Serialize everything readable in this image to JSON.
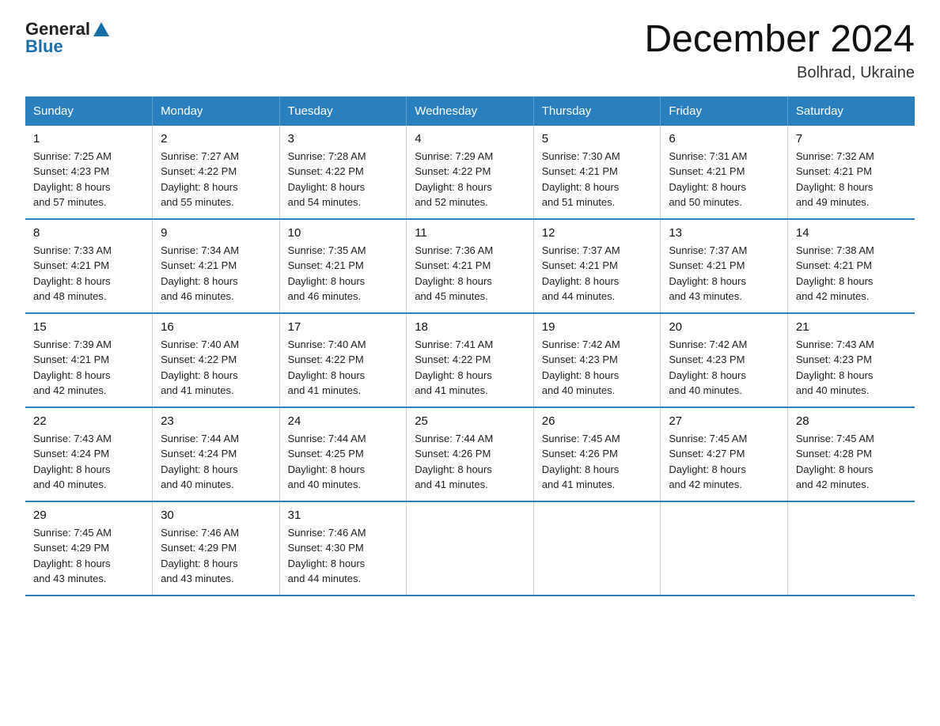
{
  "header": {
    "logo_general": "General",
    "logo_blue": "Blue",
    "month_title": "December 2024",
    "location": "Bolhrad, Ukraine"
  },
  "weekdays": [
    "Sunday",
    "Monday",
    "Tuesday",
    "Wednesday",
    "Thursday",
    "Friday",
    "Saturday"
  ],
  "weeks": [
    [
      {
        "day": "1",
        "sunrise": "Sunrise: 7:25 AM",
        "sunset": "Sunset: 4:23 PM",
        "daylight": "Daylight: 8 hours",
        "minutes": "and 57 minutes."
      },
      {
        "day": "2",
        "sunrise": "Sunrise: 7:27 AM",
        "sunset": "Sunset: 4:22 PM",
        "daylight": "Daylight: 8 hours",
        "minutes": "and 55 minutes."
      },
      {
        "day": "3",
        "sunrise": "Sunrise: 7:28 AM",
        "sunset": "Sunset: 4:22 PM",
        "daylight": "Daylight: 8 hours",
        "minutes": "and 54 minutes."
      },
      {
        "day": "4",
        "sunrise": "Sunrise: 7:29 AM",
        "sunset": "Sunset: 4:22 PM",
        "daylight": "Daylight: 8 hours",
        "minutes": "and 52 minutes."
      },
      {
        "day": "5",
        "sunrise": "Sunrise: 7:30 AM",
        "sunset": "Sunset: 4:21 PM",
        "daylight": "Daylight: 8 hours",
        "minutes": "and 51 minutes."
      },
      {
        "day": "6",
        "sunrise": "Sunrise: 7:31 AM",
        "sunset": "Sunset: 4:21 PM",
        "daylight": "Daylight: 8 hours",
        "minutes": "and 50 minutes."
      },
      {
        "day": "7",
        "sunrise": "Sunrise: 7:32 AM",
        "sunset": "Sunset: 4:21 PM",
        "daylight": "Daylight: 8 hours",
        "minutes": "and 49 minutes."
      }
    ],
    [
      {
        "day": "8",
        "sunrise": "Sunrise: 7:33 AM",
        "sunset": "Sunset: 4:21 PM",
        "daylight": "Daylight: 8 hours",
        "minutes": "and 48 minutes."
      },
      {
        "day": "9",
        "sunrise": "Sunrise: 7:34 AM",
        "sunset": "Sunset: 4:21 PM",
        "daylight": "Daylight: 8 hours",
        "minutes": "and 46 minutes."
      },
      {
        "day": "10",
        "sunrise": "Sunrise: 7:35 AM",
        "sunset": "Sunset: 4:21 PM",
        "daylight": "Daylight: 8 hours",
        "minutes": "and 46 minutes."
      },
      {
        "day": "11",
        "sunrise": "Sunrise: 7:36 AM",
        "sunset": "Sunset: 4:21 PM",
        "daylight": "Daylight: 8 hours",
        "minutes": "and 45 minutes."
      },
      {
        "day": "12",
        "sunrise": "Sunrise: 7:37 AM",
        "sunset": "Sunset: 4:21 PM",
        "daylight": "Daylight: 8 hours",
        "minutes": "and 44 minutes."
      },
      {
        "day": "13",
        "sunrise": "Sunrise: 7:37 AM",
        "sunset": "Sunset: 4:21 PM",
        "daylight": "Daylight: 8 hours",
        "minutes": "and 43 minutes."
      },
      {
        "day": "14",
        "sunrise": "Sunrise: 7:38 AM",
        "sunset": "Sunset: 4:21 PM",
        "daylight": "Daylight: 8 hours",
        "minutes": "and 42 minutes."
      }
    ],
    [
      {
        "day": "15",
        "sunrise": "Sunrise: 7:39 AM",
        "sunset": "Sunset: 4:21 PM",
        "daylight": "Daylight: 8 hours",
        "minutes": "and 42 minutes."
      },
      {
        "day": "16",
        "sunrise": "Sunrise: 7:40 AM",
        "sunset": "Sunset: 4:22 PM",
        "daylight": "Daylight: 8 hours",
        "minutes": "and 41 minutes."
      },
      {
        "day": "17",
        "sunrise": "Sunrise: 7:40 AM",
        "sunset": "Sunset: 4:22 PM",
        "daylight": "Daylight: 8 hours",
        "minutes": "and 41 minutes."
      },
      {
        "day": "18",
        "sunrise": "Sunrise: 7:41 AM",
        "sunset": "Sunset: 4:22 PM",
        "daylight": "Daylight: 8 hours",
        "minutes": "and 41 minutes."
      },
      {
        "day": "19",
        "sunrise": "Sunrise: 7:42 AM",
        "sunset": "Sunset: 4:23 PM",
        "daylight": "Daylight: 8 hours",
        "minutes": "and 40 minutes."
      },
      {
        "day": "20",
        "sunrise": "Sunrise: 7:42 AM",
        "sunset": "Sunset: 4:23 PM",
        "daylight": "Daylight: 8 hours",
        "minutes": "and 40 minutes."
      },
      {
        "day": "21",
        "sunrise": "Sunrise: 7:43 AM",
        "sunset": "Sunset: 4:23 PM",
        "daylight": "Daylight: 8 hours",
        "minutes": "and 40 minutes."
      }
    ],
    [
      {
        "day": "22",
        "sunrise": "Sunrise: 7:43 AM",
        "sunset": "Sunset: 4:24 PM",
        "daylight": "Daylight: 8 hours",
        "minutes": "and 40 minutes."
      },
      {
        "day": "23",
        "sunrise": "Sunrise: 7:44 AM",
        "sunset": "Sunset: 4:24 PM",
        "daylight": "Daylight: 8 hours",
        "minutes": "and 40 minutes."
      },
      {
        "day": "24",
        "sunrise": "Sunrise: 7:44 AM",
        "sunset": "Sunset: 4:25 PM",
        "daylight": "Daylight: 8 hours",
        "minutes": "and 40 minutes."
      },
      {
        "day": "25",
        "sunrise": "Sunrise: 7:44 AM",
        "sunset": "Sunset: 4:26 PM",
        "daylight": "Daylight: 8 hours",
        "minutes": "and 41 minutes."
      },
      {
        "day": "26",
        "sunrise": "Sunrise: 7:45 AM",
        "sunset": "Sunset: 4:26 PM",
        "daylight": "Daylight: 8 hours",
        "minutes": "and 41 minutes."
      },
      {
        "day": "27",
        "sunrise": "Sunrise: 7:45 AM",
        "sunset": "Sunset: 4:27 PM",
        "daylight": "Daylight: 8 hours",
        "minutes": "and 42 minutes."
      },
      {
        "day": "28",
        "sunrise": "Sunrise: 7:45 AM",
        "sunset": "Sunset: 4:28 PM",
        "daylight": "Daylight: 8 hours",
        "minutes": "and 42 minutes."
      }
    ],
    [
      {
        "day": "29",
        "sunrise": "Sunrise: 7:45 AM",
        "sunset": "Sunset: 4:29 PM",
        "daylight": "Daylight: 8 hours",
        "minutes": "and 43 minutes."
      },
      {
        "day": "30",
        "sunrise": "Sunrise: 7:46 AM",
        "sunset": "Sunset: 4:29 PM",
        "daylight": "Daylight: 8 hours",
        "minutes": "and 43 minutes."
      },
      {
        "day": "31",
        "sunrise": "Sunrise: 7:46 AM",
        "sunset": "Sunset: 4:30 PM",
        "daylight": "Daylight: 8 hours",
        "minutes": "and 44 minutes."
      },
      null,
      null,
      null,
      null
    ]
  ]
}
